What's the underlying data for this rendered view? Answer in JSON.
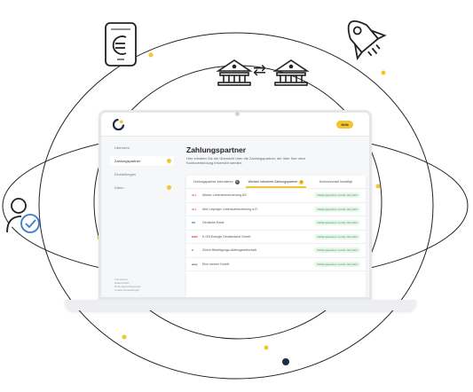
{
  "header": {
    "cta_label": "Hilfe",
    "accent_color": "#f5c431"
  },
  "sidebar": {
    "items": [
      {
        "label": "Ubersicht",
        "active": false,
        "dot": false
      },
      {
        "label": "Zahlungspartner",
        "active": true,
        "dot": true
      },
      {
        "label": "Einstellungen",
        "active": false,
        "dot": false
      },
      {
        "label": "Daten",
        "active": false,
        "dot": true
      }
    ],
    "footer": [
      "Impressum",
      "Datenschutz",
      "Nutzungsbedingungen",
      "Cookie-Einstellungen"
    ]
  },
  "main": {
    "title": "Zahlungspartner",
    "subtitle": "Hier erhalten Sie die Übersicht über die Zahlungspartner, die über Ihre neue Kontoverbindung informiert werden.",
    "tabs": [
      {
        "label": "Zahlungspartner informieren",
        "badge": "6",
        "active": false
      },
      {
        "label": "Werden informiert Zahlungspartner",
        "badge": "6",
        "active": true
      },
      {
        "label": "Kontowechsel bestätigt",
        "badge": "",
        "active": false
      }
    ],
    "rows": [
      {
        "logo": "ALL",
        "logo_color": "#d9534f",
        "name": "Allianz Lebensversicherung AG",
        "status": "Zahlungspartner wurde informiert"
      },
      {
        "logo": "ALL",
        "logo_color": "#d9534f",
        "name": "Alte Leipziger Lebensversicherung a.G.",
        "status": "Zahlungspartner wurde informiert"
      },
      {
        "logo": "DB",
        "logo_color": "#2a7ac0",
        "name": "Deutsche Bank",
        "status": "Zahlungspartner wurde informiert"
      },
      {
        "logo": "EON",
        "logo_color": "#e2231a",
        "name": "E.ON Energie Deutschland GmbH",
        "status": "Zahlungspartner wurde informiert"
      },
      {
        "logo": "Z",
        "logo_color": "#2b4a9a",
        "name": "Zürich Beteiligungs-Aktiengesellschaft",
        "status": "Zahlungspartner wurde informiert"
      },
      {
        "logo": "easy",
        "logo_color": "#444444",
        "name": "Eins meiner GmbH",
        "status": "Zahlungspartner wurde informiert"
      }
    ]
  },
  "decor": {
    "exchange_arrows": "⇄",
    "icons": [
      "euro-phone-icon",
      "bank-icon",
      "bank-icon",
      "rocket-icon",
      "user-check-icon"
    ]
  }
}
